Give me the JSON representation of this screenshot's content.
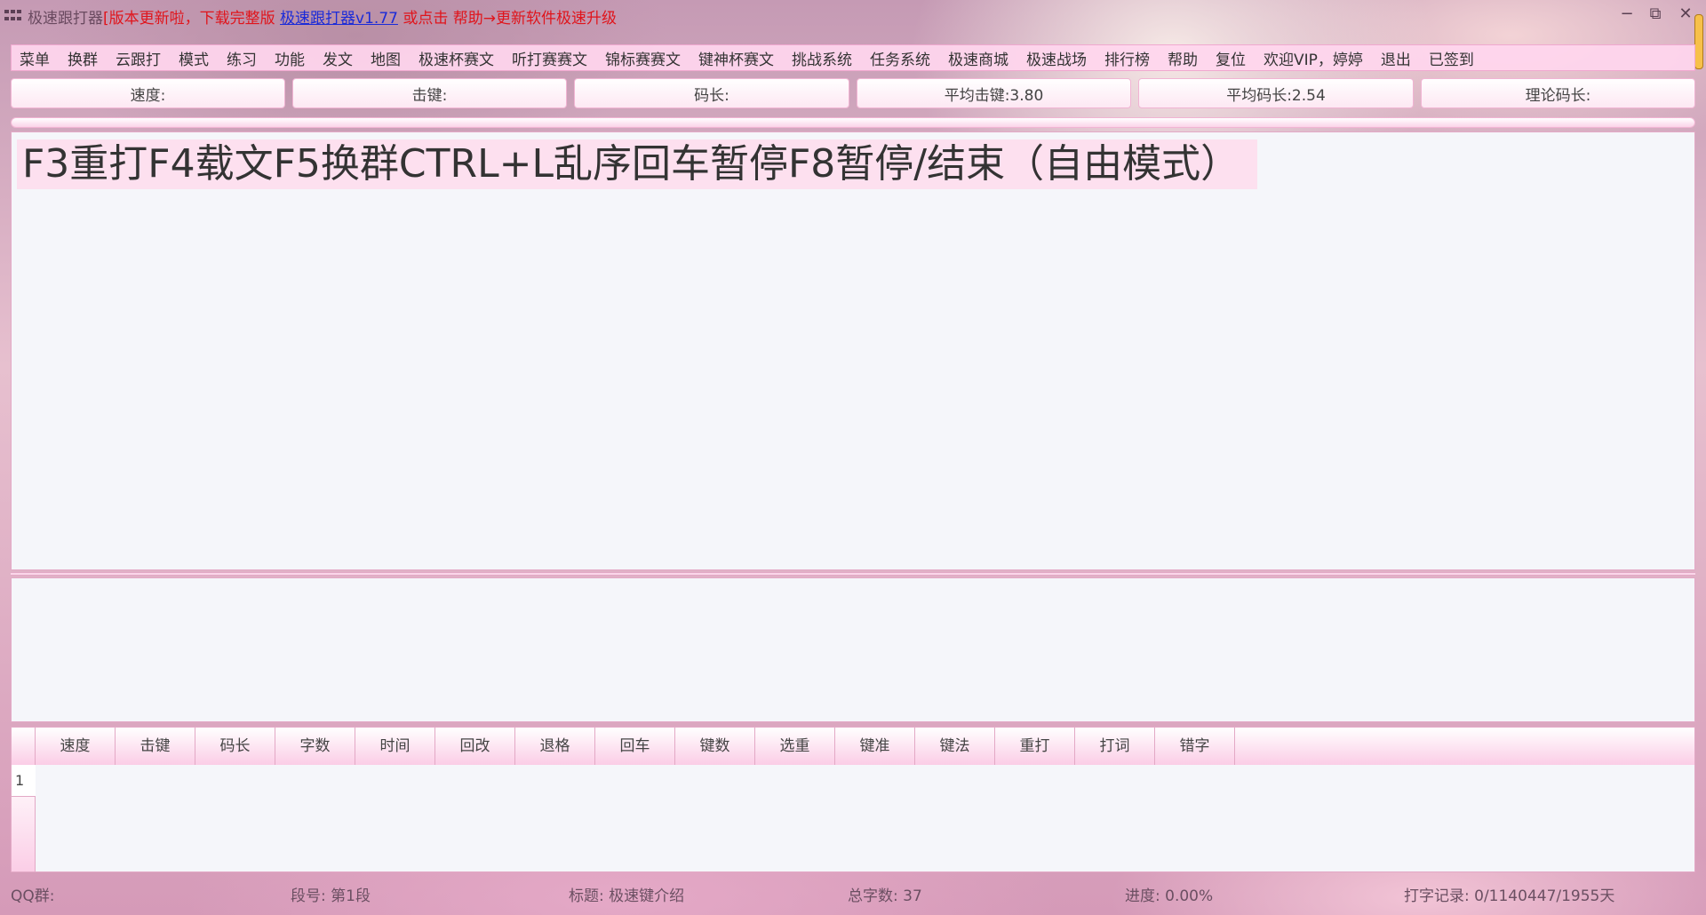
{
  "titlebar": {
    "app_name": "极速跟打器",
    "notice": "[版本更新啦，下载完整版",
    "link_text": "极速跟打器v1.77",
    "notice_tail": "或点击 帮助→更新软件极速升级",
    "minimize": "−",
    "restore": "⧉",
    "close": "✕"
  },
  "menu": [
    "菜单",
    "换群",
    "云跟打",
    "模式",
    "练习",
    "功能",
    "发文",
    "地图",
    "极速杯赛文",
    "听打赛赛文",
    "锦标赛赛文",
    "键神杯赛文",
    "挑战系统",
    "任务系统",
    "极速商城",
    "极速战场",
    "排行榜",
    "帮助",
    "复位",
    "欢迎VIP，婷婷",
    "退出",
    "已签到"
  ],
  "stats": {
    "speed": "速度:",
    "keystroke": "击键:",
    "code_len": "码长:",
    "avg_keystroke": "平均击键:3.80",
    "avg_code_len": "平均码长:2.54",
    "theory_code_len": "理论码长:"
  },
  "display": {
    "text": "F3重打F4载文F5换群CTRL+L乱序回车暂停F8暂停/结束（自由模式）"
  },
  "results": {
    "columns": [
      "速度",
      "击键",
      "码长",
      "字数",
      "时间",
      "回改",
      "退格",
      "回车",
      "键数",
      "选重",
      "键准",
      "键法",
      "重打",
      "打词",
      "错字"
    ],
    "row_numbers": [
      "1"
    ]
  },
  "status": {
    "qq_group": "QQ群:",
    "segment": "段号: 第1段",
    "source": "标题: 极速键介绍",
    "total_chars": "总字数: 37",
    "progress": "进度: 0.00%",
    "record": "打字记录: 0/1140447/1955天"
  },
  "colors": {
    "accent_pink": "#fbd6e9",
    "notice_red": "#e0141b",
    "link_blue": "#1b2bd8"
  }
}
